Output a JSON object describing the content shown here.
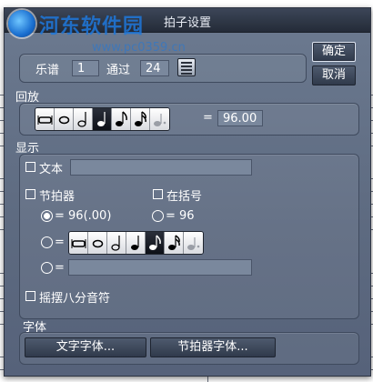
{
  "window": {
    "title": "拍子设置"
  },
  "watermark": {
    "site_name": "河东软件园",
    "url": "www.pc0359.cn"
  },
  "header": {
    "score_label": "乐谱",
    "score_value": "1",
    "through_label": "通过",
    "through_value": "24"
  },
  "actions": {
    "ok_label": "确定",
    "cancel_label": "取消"
  },
  "playback": {
    "section_label": "回放",
    "equals_sign": "=",
    "tempo_value": "96.00",
    "selected_note": "quarter"
  },
  "display": {
    "section_label": "显示",
    "text_checkbox_label": "文本",
    "text_value": "",
    "metronome_checkbox_label": "节拍器",
    "parentheses_checkbox_label": "在括号",
    "option1_text": "= 96(.00)",
    "option1_alt_text": "= 96",
    "option2_equals": "=",
    "option3_equals": "=",
    "option3_value": "",
    "selected_note": "eighth",
    "swing_checkbox_label": "摇摆八分音符"
  },
  "fonts": {
    "section_label": "字体",
    "text_font_button": "文字字体...",
    "metronome_font_button": "节拍器字体..."
  },
  "note_values": [
    "breve",
    "whole",
    "half",
    "quarter",
    "eighth",
    "sixteenth",
    "dotted-rest"
  ],
  "colors": {
    "dialog_bg": "#5d6a80",
    "titlebar": "#242b38",
    "selected_note": "#0e1118"
  }
}
